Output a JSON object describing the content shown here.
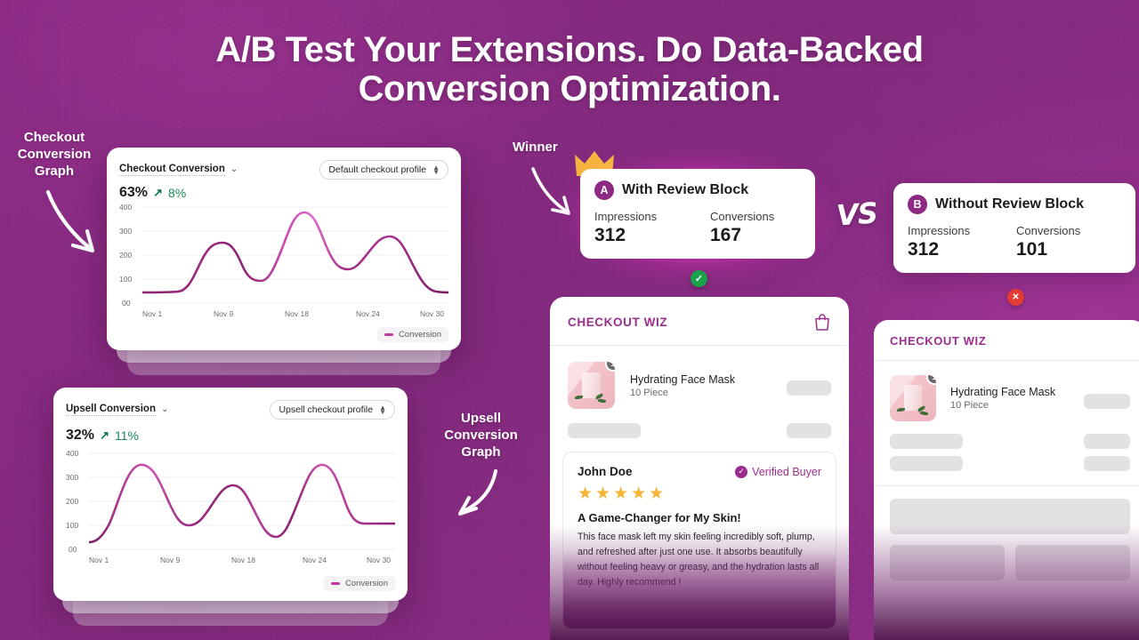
{
  "theme": {
    "background_purple": "#8a2b83",
    "brand_magenta": "#9b2d8d",
    "accent_glow": "#ff46dc",
    "positive_green": "#1a8a55",
    "star_gold": "#f5b431"
  },
  "headline": {
    "line1": "A/B Test Your Extensions. Do Data-Backed",
    "line2": "Conversion Optimization."
  },
  "annotations": {
    "checkout_graph": "Checkout\nConversion\nGraph",
    "checkout_graph_l1": "Checkout",
    "checkout_graph_l2": "Conversion",
    "checkout_graph_l3": "Graph",
    "upsell_graph_l1": "Upsell",
    "upsell_graph_l2": "Conversion",
    "upsell_graph_l3": "Graph",
    "winner": "Winner",
    "vs": "VS"
  },
  "checkout_chart": {
    "title": "Checkout Conversion",
    "chevron": "⌄",
    "profile_selector": "Default checkout profile",
    "kpi_value": "63%",
    "kpi_arrow": "↗",
    "kpi_delta": "8%",
    "legend": "Conversion"
  },
  "upsell_chart": {
    "title": "Upsell Conversion",
    "chevron": "⌄",
    "profile_selector": "Upsell checkout profile",
    "kpi_value": "32%",
    "kpi_arrow": "↗",
    "kpi_delta": "11%",
    "legend": "Conversion"
  },
  "ab_test": {
    "variant_a": {
      "badge": "A",
      "prefix": "With",
      "name": "Review Block",
      "impressions_label": "Impressions",
      "impressions_value": "312",
      "conversions_label": "Conversions",
      "conversions_value": "167",
      "status": "✓",
      "status_color": "#18a34a",
      "is_winner": true
    },
    "variant_b": {
      "badge": "B",
      "prefix": "Without",
      "name": "Review Block",
      "impressions_label": "Impressions",
      "impressions_value": "312",
      "conversions_label": "Conversions",
      "conversions_value": "101",
      "status": "✕",
      "status_color": "#e23b36",
      "is_winner": false
    }
  },
  "wiz_left": {
    "brand": "CHECKOUT WIZ",
    "product_name": "Hydrating Face Mask",
    "product_variant": "10 Piece",
    "quantity_badge": "1"
  },
  "wiz_right": {
    "brand": "CHECKOUT WIZ",
    "product_name": "Hydrating Face Mask",
    "product_variant": "10 Piece",
    "quantity_badge": "1"
  },
  "review": {
    "author": "John Doe",
    "verified_label": "Verified Buyer",
    "verified_check": "✓",
    "stars": "★★★★★",
    "rating": 5,
    "title": "A Game-Changer for My Skin!",
    "body": "This face mask left my skin feeling incredibly soft, plump, and refreshed after just one use. It absorbs beautifully without feeling heavy or greasy, and the hydration lasts all day. Highly recommend !"
  },
  "chart_data": [
    {
      "type": "line",
      "title": "Checkout Conversion",
      "xlabel": "",
      "ylabel": "",
      "ylim": [
        0,
        400
      ],
      "ytick_labels": [
        "400",
        "300",
        "200",
        "100",
        "00"
      ],
      "yticks": [
        400,
        300,
        200,
        100,
        0
      ],
      "xtick_labels": [
        "Nov 1",
        "Nov 9",
        "Nov 18",
        "Nov 24",
        "Nov 30"
      ],
      "grid": true,
      "legend": [
        "Conversion"
      ],
      "legend_position": "bottom-right",
      "series": [
        {
          "name": "Conversion",
          "x": [
            1,
            3,
            5,
            6,
            7,
            9,
            11,
            12,
            13,
            15,
            16,
            18,
            20,
            21,
            22,
            24,
            26,
            27,
            28,
            30
          ],
          "values": [
            45,
            45,
            48,
            95,
            180,
            228,
            200,
            130,
            95,
            150,
            280,
            375,
            300,
            190,
            168,
            200,
            278,
            250,
            140,
            48
          ]
        }
      ]
    },
    {
      "type": "line",
      "title": "Upsell Conversion",
      "xlabel": "",
      "ylabel": "",
      "ylim": [
        0,
        400
      ],
      "ytick_labels": [
        "400",
        "300",
        "200",
        "100",
        "00"
      ],
      "yticks": [
        400,
        300,
        200,
        100,
        0
      ],
      "xtick_labels": [
        "Nov 1",
        "Nov 9",
        "Nov 18",
        "Nov 24",
        "Nov 30"
      ],
      "grid": true,
      "legend": [
        "Conversion"
      ],
      "legend_position": "bottom-right",
      "series": [
        {
          "name": "Conversion",
          "x": [
            1,
            2,
            4,
            6,
            7,
            9,
            11,
            12,
            14,
            16,
            18,
            20,
            21,
            22,
            24,
            25,
            26,
            28,
            29,
            30
          ],
          "values": [
            32,
            45,
            175,
            345,
            330,
            220,
            120,
            95,
            130,
            230,
            265,
            180,
            90,
            45,
            200,
            345,
            340,
            100,
            95,
            95
          ]
        }
      ]
    }
  ]
}
